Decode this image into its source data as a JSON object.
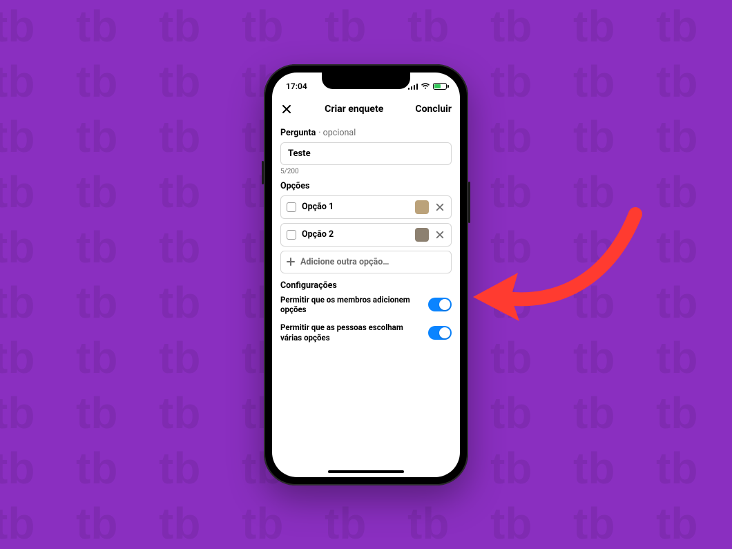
{
  "status": {
    "time": "17:04"
  },
  "header": {
    "title": "Criar enquete",
    "done": "Concluir"
  },
  "question": {
    "label": "Pergunta",
    "optional_hint": "· opcional",
    "value": "Teste",
    "counter": "5/200"
  },
  "options_section": {
    "heading": "Opções",
    "items": [
      {
        "label": "Opção 1"
      },
      {
        "label": "Opção 2"
      }
    ],
    "add_label": "Adicione outra opção…"
  },
  "settings_section": {
    "heading": "Configurações",
    "items": [
      {
        "label": "Permitir que os membros adicionem opções",
        "on": true
      },
      {
        "label": "Permitir que as pessoas escolham várias opções",
        "on": true
      }
    ]
  },
  "colors": {
    "accent": "#0a84ff",
    "page_bg": "#8a2fc0",
    "callout": "#ff3b30"
  }
}
